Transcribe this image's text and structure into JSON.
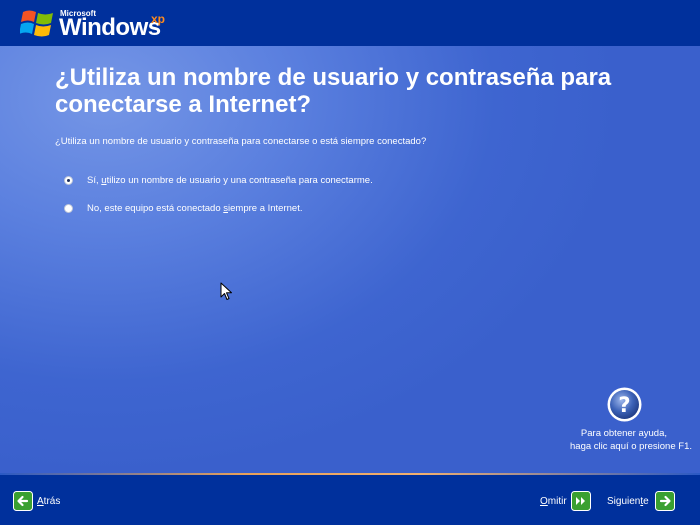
{
  "header": {
    "brand_microsoft": "Microsoft",
    "brand_windows": "Windows",
    "brand_xp": "xp"
  },
  "main": {
    "title": "¿Utiliza un nombre de usuario y contraseña para conectarse a Internet?",
    "question": "¿Utiliza un nombre de usuario y contraseña para conectarse o está siempre conectado?",
    "options": [
      {
        "pre": "Sí, ",
        "key": "u",
        "post": "tilizo un nombre de usuario y una contraseña para conectarme.",
        "selected": true
      },
      {
        "pre": "No, este equipo está conectado ",
        "key": "s",
        "post": "iempre a Internet.",
        "selected": false
      }
    ]
  },
  "help": {
    "icon": "help-icon",
    "line1": "Para obtener ayuda,",
    "line2": "haga clic aquí o presione F1."
  },
  "footer": {
    "back": {
      "key": "A",
      "rest": "trás",
      "icon": "back-arrow-icon"
    },
    "skip": {
      "key": "O",
      "rest": "mitir",
      "icon": "skip-icon"
    },
    "next": {
      "pre": "Siguien",
      "key": "t",
      "post": "e",
      "icon": "next-arrow-icon"
    }
  },
  "colors": {
    "header_footer": "#00309c",
    "background": "#3d63cf",
    "text": "#ffffff",
    "button_green": "#3aa031",
    "accent_orange": "#e7a15a"
  }
}
